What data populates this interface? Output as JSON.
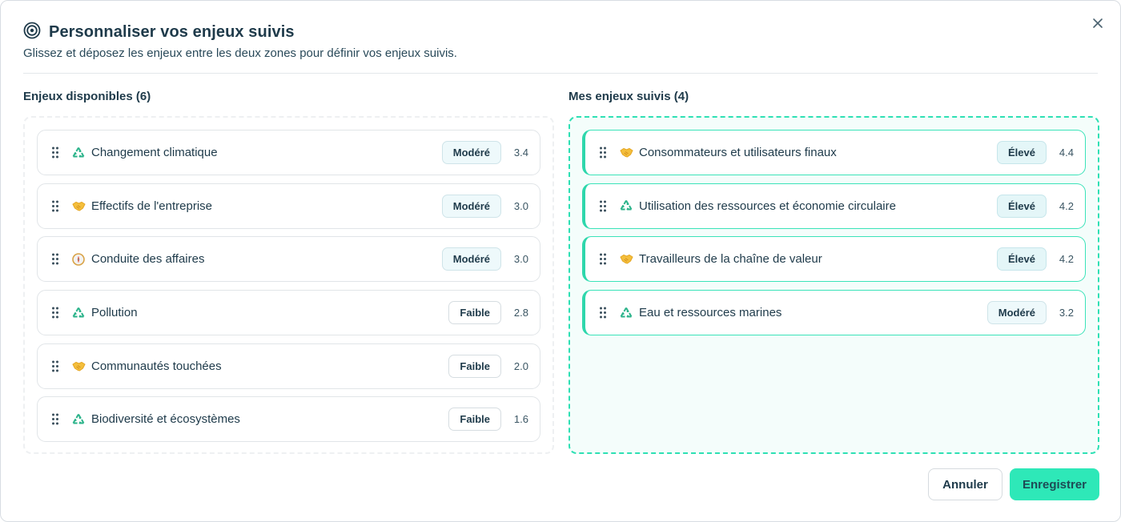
{
  "modal": {
    "title": "Personnaliser vos enjeux suivis",
    "subtitle": "Glissez et déposez les enjeux entre les deux zones pour définir vos enjeux suivis.",
    "title_icon": "target-icon",
    "close_icon": "close-icon"
  },
  "available": {
    "title": "Enjeux disponibles (6)",
    "items": [
      {
        "label": "Changement climatique",
        "badge": "Modéré",
        "score": "3.4",
        "icon": "recycle-icon"
      },
      {
        "label": "Effectifs de l'entreprise",
        "badge": "Modéré",
        "score": "3.0",
        "icon": "handshake-icon"
      },
      {
        "label": "Conduite des affaires",
        "badge": "Modéré",
        "score": "3.0",
        "icon": "compass-icon"
      },
      {
        "label": "Pollution",
        "badge": "Faible",
        "score": "2.8",
        "icon": "recycle-icon"
      },
      {
        "label": "Communautés touchées",
        "badge": "Faible",
        "score": "2.0",
        "icon": "handshake-icon"
      },
      {
        "label": "Biodiversité et écosystèmes",
        "badge": "Faible",
        "score": "1.6",
        "icon": "recycle-icon"
      }
    ]
  },
  "tracked": {
    "title": "Mes enjeux suivis (4)",
    "items": [
      {
        "label": "Consommateurs et utilisateurs finaux",
        "badge": "Élevé",
        "score": "4.4",
        "icon": "handshake-icon"
      },
      {
        "label": "Utilisation des ressources et économie circulaire",
        "badge": "Élevé",
        "score": "4.2",
        "icon": "recycle-icon"
      },
      {
        "label": "Travailleurs de la chaîne de valeur",
        "badge": "Élevé",
        "score": "4.2",
        "icon": "handshake-icon"
      },
      {
        "label": "Eau et ressources marines",
        "badge": "Modéré",
        "score": "3.2",
        "icon": "recycle-icon"
      }
    ]
  },
  "footer": {
    "cancel_label": "Annuler",
    "save_label": "Enregistrer"
  },
  "colors": {
    "accent": "#2ee8b8",
    "text": "#1e3a4a"
  }
}
